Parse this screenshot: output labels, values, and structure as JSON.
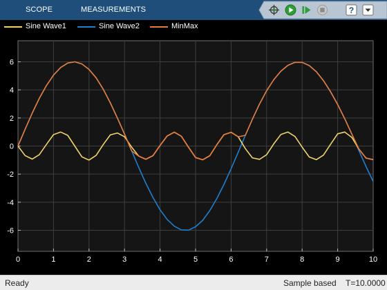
{
  "toolstrip": {
    "tabs": [
      {
        "label": "SCOPE"
      },
      {
        "label": "MEASUREMENTS"
      }
    ],
    "buttons": [
      {
        "icon": "signal-select-icon"
      },
      {
        "icon": "run-icon"
      },
      {
        "icon": "step-forward-icon"
      },
      {
        "icon": "stop-icon"
      },
      {
        "icon": "help-icon"
      },
      {
        "icon": "expand-menu-icon"
      }
    ]
  },
  "status": {
    "state": "Ready",
    "mode": "Sample based",
    "time": "T=10.0000"
  },
  "colors": {
    "toolstrip_bg": "#1e4e79",
    "plot_bg": "#151515",
    "axes_bg": "#000000",
    "grid": "#3f3f3f",
    "tick_text": "#ffffff",
    "series1": "#f0d469",
    "series2": "#1f7fd0",
    "series3": "#e87b3a"
  },
  "chart_data": {
    "type": "line",
    "title": "",
    "xlabel": "",
    "ylabel": "",
    "xlim": [
      0,
      10
    ],
    "ylim": [
      -7.5,
      7.5
    ],
    "xticks": [
      0,
      1,
      2,
      3,
      4,
      5,
      6,
      7,
      8,
      9,
      10
    ],
    "yticks": [
      -6,
      -4,
      -2,
      0,
      2,
      4,
      6
    ],
    "grid": true,
    "legend": "top-left",
    "x": [
      0,
      0.2,
      0.4,
      0.6,
      0.8,
      1,
      1.2,
      1.4,
      1.6,
      1.8,
      2,
      2.2,
      2.4,
      2.6,
      2.8,
      3,
      3.2,
      3.4,
      3.6,
      3.8,
      4,
      4.2,
      4.4,
      4.6,
      4.8,
      5,
      5.2,
      5.4,
      5.6,
      5.8,
      6,
      6.2,
      6.4,
      6.6,
      6.8,
      7,
      7.2,
      7.4,
      7.6,
      7.8,
      8,
      8.2,
      8.4,
      8.6,
      8.8,
      9,
      9.2,
      9.4,
      9.6,
      9.8,
      10
    ],
    "series": [
      {
        "name": "Sine Wave1",
        "color": "#f0d469",
        "values": [
          0,
          -0.68,
          -0.93,
          -0.62,
          0.11,
          0.81,
          1.0,
          0.76,
          0.0,
          -0.77,
          -1.0,
          -0.67,
          0.11,
          0.79,
          0.93,
          0.66,
          -0.08,
          -0.72,
          -0.94,
          -0.69,
          0.04,
          0.72,
          0.99,
          0.7,
          -0.08,
          -0.82,
          -0.98,
          -0.69,
          0.1,
          0.81,
          0.98,
          0.66,
          -0.18,
          -0.84,
          -0.95,
          -0.62,
          0.15,
          0.82,
          1.0,
          0.68,
          -0.08,
          -0.78,
          -0.97,
          -0.65,
          0.12,
          0.87,
          1.0,
          0.61,
          -0.22,
          -0.86,
          -0.97
        ]
      },
      {
        "name": "Sine Wave2",
        "color": "#1f7fd0",
        "values": [
          0,
          1.19,
          2.34,
          3.39,
          4.3,
          5.05,
          5.59,
          5.91,
          6.0,
          5.85,
          5.46,
          4.86,
          4.05,
          3.08,
          1.99,
          0.85,
          -0.35,
          -1.53,
          -2.65,
          -3.66,
          -4.54,
          -5.23,
          -5.71,
          -5.97,
          -5.99,
          -5.75,
          -5.29,
          -4.6,
          -3.74,
          -2.73,
          -1.62,
          -0.44,
          0.76,
          1.91,
          2.99,
          3.94,
          4.72,
          5.33,
          5.75,
          5.96,
          5.96,
          5.73,
          5.29,
          4.66,
          3.87,
          2.96,
          1.94,
          0.84,
          -0.33,
          -1.46,
          -2.53
        ]
      },
      {
        "name": "MinMax",
        "color": "#e87b3a",
        "values": [
          0,
          1.19,
          2.34,
          3.39,
          4.3,
          5.05,
          5.59,
          5.91,
          6.0,
          5.85,
          5.46,
          4.86,
          4.05,
          3.08,
          1.99,
          0.85,
          -0.35,
          -0.72,
          -0.94,
          -0.69,
          0.04,
          0.72,
          0.99,
          0.7,
          -0.08,
          -0.82,
          -0.98,
          -0.69,
          0.1,
          0.81,
          0.98,
          0.66,
          0.76,
          1.91,
          2.99,
          3.94,
          4.72,
          5.33,
          5.75,
          5.96,
          5.96,
          5.73,
          5.29,
          4.66,
          3.87,
          2.96,
          1.94,
          0.84,
          -0.22,
          -0.86,
          -0.97
        ]
      }
    ]
  }
}
